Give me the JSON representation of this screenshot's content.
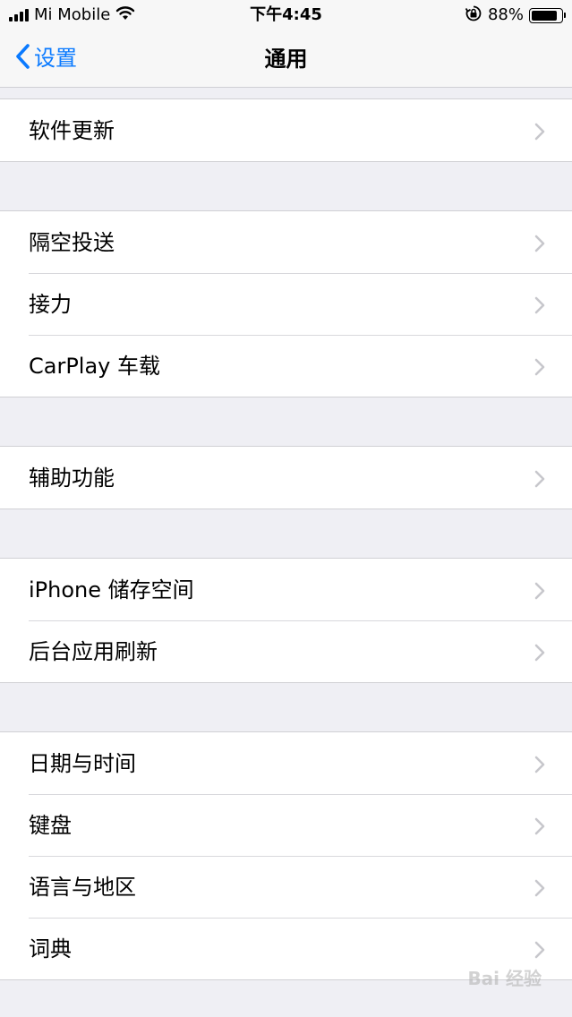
{
  "status_bar": {
    "carrier": "Mi Mobile",
    "time": "下午4:45",
    "battery_percent": "88%",
    "battery_level": 0.88,
    "icons": [
      "signal-icon",
      "wifi-icon",
      "rotation-lock-icon",
      "battery-icon"
    ]
  },
  "nav": {
    "back_label": "设置",
    "title": "通用"
  },
  "groups": [
    {
      "rows": [
        {
          "label": "软件更新"
        }
      ]
    },
    {
      "rows": [
        {
          "label": "隔空投送"
        },
        {
          "label": "接力"
        },
        {
          "label": "CarPlay 车载"
        }
      ]
    },
    {
      "rows": [
        {
          "label": "辅助功能"
        }
      ]
    },
    {
      "rows": [
        {
          "label": "iPhone 储存空间"
        },
        {
          "label": "后台应用刷新"
        }
      ]
    },
    {
      "rows": [
        {
          "label": "日期与时间"
        },
        {
          "label": "键盘"
        },
        {
          "label": "语言与地区"
        },
        {
          "label": "词典"
        }
      ]
    }
  ],
  "colors": {
    "accent": "#0a7aff",
    "background": "#efeff4",
    "chevron": "#c7c7cc"
  }
}
